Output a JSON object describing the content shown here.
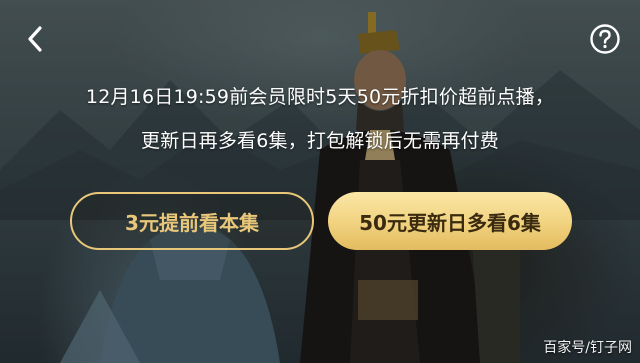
{
  "header": {
    "back_icon": "chevron-left-icon",
    "help_icon": "question-circle-icon"
  },
  "promo": {
    "line1": "12月16日19:59前会员限时5天50元折扣价超前点播，",
    "line2": "更新日再多看6集，打包解锁后无需再付费"
  },
  "buttons": {
    "single_label": "3元提前看本集",
    "bundle_label": "50元更新日多看6集"
  },
  "watermark": "百家号/钉子网",
  "colors": {
    "gold": "#e8c77a",
    "gold_fill": "#f1d27f",
    "text": "#ffffff"
  }
}
